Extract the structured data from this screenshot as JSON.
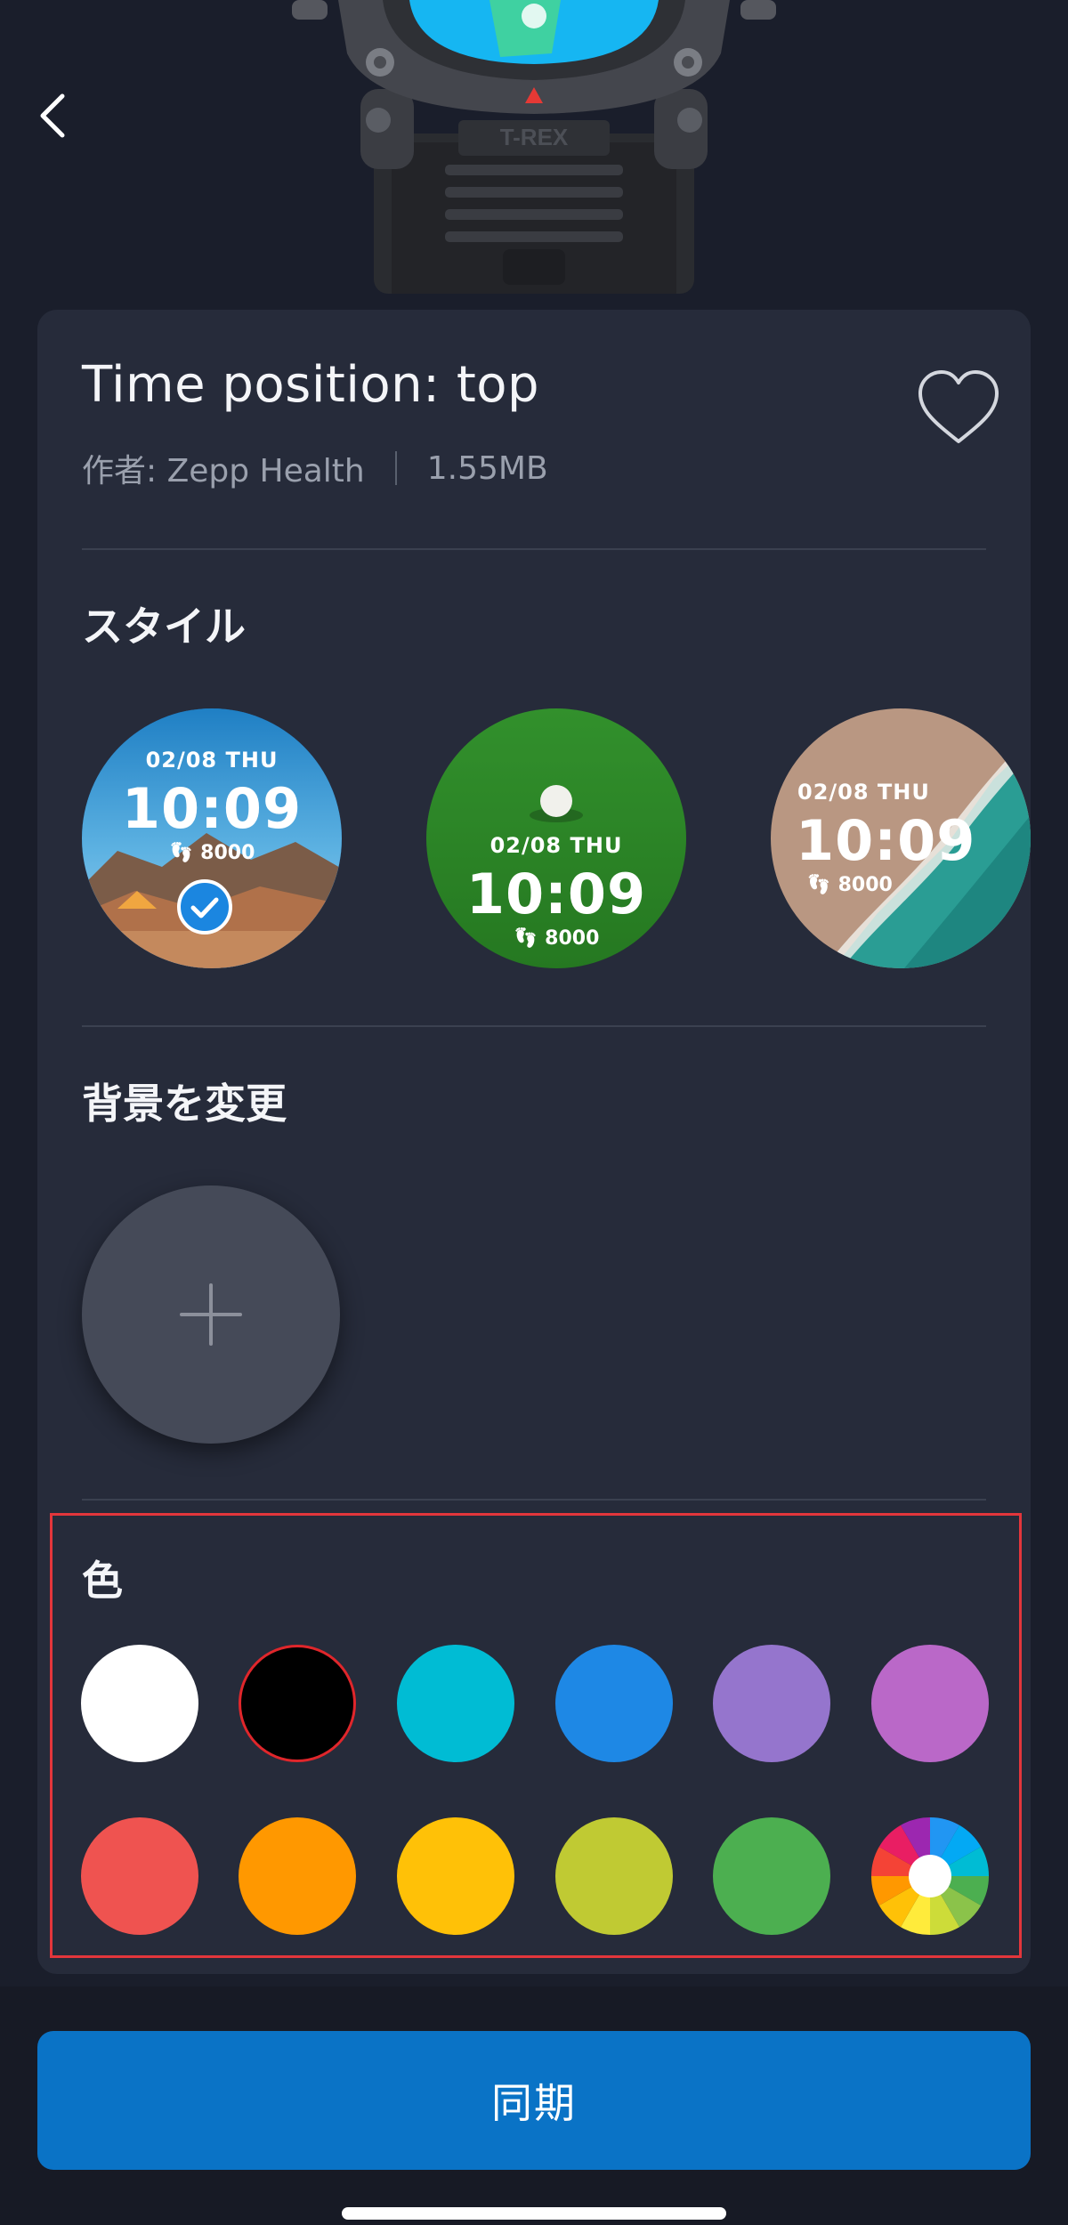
{
  "header": {
    "back_icon": "chevron-left-icon",
    "watch_brand": "T-REX"
  },
  "watchface": {
    "title": "Time position: top",
    "author": "作者: Zepp Health",
    "size": "1.55MB",
    "favorite_icon": "heart-outline-icon"
  },
  "style_section": {
    "title": "スタイル",
    "options": [
      {
        "date": "02/08  THU",
        "time": "10:09",
        "steps": "8000",
        "theme": "mountain",
        "selected": true
      },
      {
        "date": "02/08  THU",
        "time": "10:09",
        "steps": "8000",
        "theme": "grass",
        "selected": false
      },
      {
        "date": "02/08  THU",
        "time": "10:09",
        "steps": "8000",
        "theme": "beach",
        "selected": false
      }
    ]
  },
  "background_section": {
    "title": "背景を変更",
    "add_icon": "plus-icon"
  },
  "color_section": {
    "title": "色",
    "selected_index": 1,
    "colors": [
      "#ffffff",
      "#000000",
      "#00bcd4",
      "#1e88e5",
      "#9575cd",
      "#ba68c8",
      "#ef5350",
      "#ff9800",
      "#ffc107",
      "#c0ca33",
      "#4caf50",
      "custom-color-wheel"
    ]
  },
  "actions": {
    "sync_label": "同期"
  },
  "colors": {
    "accent": "#1b86e0",
    "sync_button": "#0a73c6",
    "highlight_border": "#e3363b",
    "card_bg": "#262b3a",
    "page_bg": "#1a1e2b"
  }
}
